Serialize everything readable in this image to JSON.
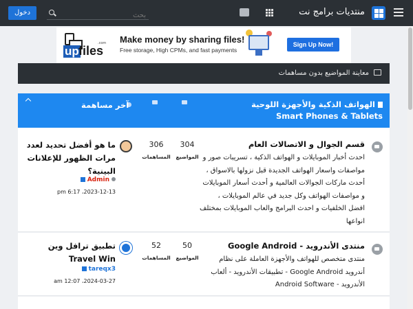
{
  "header": {
    "site_title": "منتديات برامج نت",
    "search_placeholder": "بحث",
    "login_label": "دخول"
  },
  "ad": {
    "brand_up": "up",
    "brand_files": "files",
    "brand_com": ".com",
    "headline": "Make money by sharing files!",
    "subline": "Free storage, High CPMs, and fast payments",
    "cta": "Sign Up Now!"
  },
  "unread_bar": {
    "label": "معاينة المواضيع بدون مساهمات"
  },
  "category": {
    "title": "الهواتف الذكية والأجهزة اللوحية Smart Phones & Tablets",
    "last_post_label": "آخر مساهمة"
  },
  "forums": [
    {
      "title": "قسم الجوال و الاتصالات العام",
      "description": "احدث أخبار الموبايلات و الهواتف الذكية ، تسريبات صور و مواصفات واسعار الهواتف الجديدة قبل نزولها بالاسواق ، أحدث ماركات الجوالات العالمية و أحدث أسعار الموبايلات و مواصفات الهواتف وكل جديد في عالم الموبايلات ، افضل الخلفيات و احدث البرامج والعاب الموبايلات بمختلف انواعها",
      "topics": "304",
      "topics_label": "المواضيع",
      "posts": "306",
      "posts_label": "المساهمات",
      "last_title": "ما هو أفضل تحديد لعدد مرات الظهور للإعلانات البينية؟",
      "last_author": "Admin",
      "last_date": "2023-12-13، 6:17 pm"
    },
    {
      "title": "منتدى الأندرويد - Google Android",
      "description": "منتدى متخصص للهواتف والأجهزة العاملة على نظام أندرويد Google Android - تطبيقات الأندرويد - ألعاب الأندرويد - Android Software",
      "topics": "50",
      "topics_label": "المواضيع",
      "posts": "52",
      "posts_label": "المساهمات",
      "last_title": "تطبيق ترافل وين Travel Win",
      "last_author": "tareqx3",
      "last_date": "2024-03-27، 12:07 am"
    }
  ],
  "colors": {
    "topbar": "#2b3035",
    "accent": "#1e88f0",
    "login": "#1e73d8"
  }
}
